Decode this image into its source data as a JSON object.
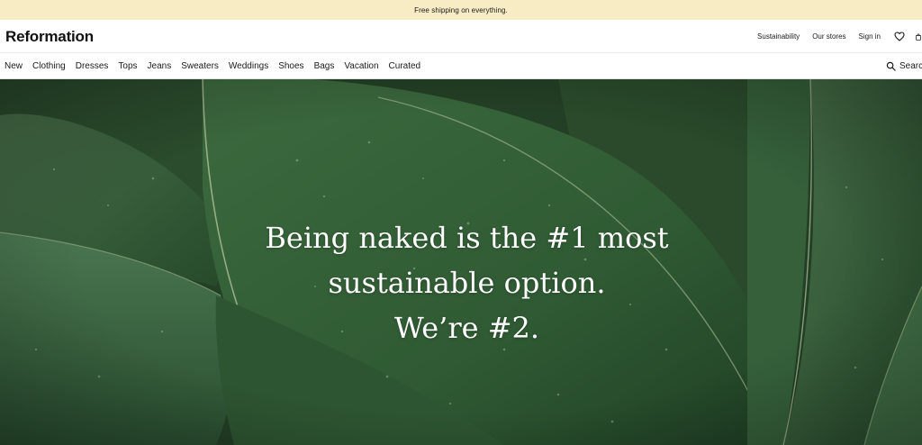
{
  "promo": {
    "text": "Free shipping on everything."
  },
  "header": {
    "logo": "Reformation",
    "utility_links": {
      "sustainability": "Sustainability",
      "stores": "Our stores",
      "sign_in": "Sign in"
    },
    "icons": [
      "heart-icon",
      "bag-icon"
    ]
  },
  "nav": {
    "items": [
      "New",
      "Clothing",
      "Dresses",
      "Tops",
      "Jeans",
      "Sweaters",
      "Weddings",
      "Shoes",
      "Bags",
      "Vacation",
      "Curated"
    ],
    "search_label": "Search",
    "search_icon": "search-icon"
  },
  "hero": {
    "lines": [
      "Being naked is the #1 most",
      "sustainable option.",
      "We’re #2."
    ]
  },
  "colors": {
    "promo_bg": "#f7ecc4",
    "hero_green": "#2e4f2c",
    "text_dark": "#1a1a1a"
  }
}
